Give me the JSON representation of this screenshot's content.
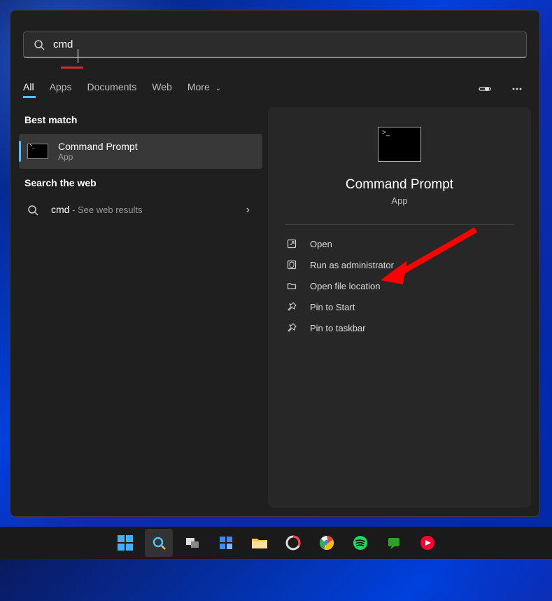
{
  "search": {
    "query": "cmd"
  },
  "tabs": {
    "items": [
      "All",
      "Apps",
      "Documents",
      "Web",
      "More"
    ],
    "active_index": 0
  },
  "left": {
    "section_best": "Best match",
    "best_result": {
      "title": "Command Prompt",
      "subtitle": "App"
    },
    "section_web": "Search the web",
    "web_result": {
      "query": "cmd",
      "suffix": " - See web results"
    }
  },
  "preview": {
    "title": "Command Prompt",
    "subtitle": "App",
    "actions": [
      {
        "icon": "open-external-icon",
        "label": "Open"
      },
      {
        "icon": "shield-icon",
        "label": "Run as administrator"
      },
      {
        "icon": "folder-icon",
        "label": "Open file location"
      },
      {
        "icon": "pin-icon",
        "label": "Pin to Start"
      },
      {
        "icon": "pin-icon",
        "label": "Pin to taskbar"
      }
    ]
  },
  "annotation": {
    "arrow_color": "#ff0000",
    "points_to": "Run as administrator"
  },
  "taskbar": {
    "items": [
      {
        "name": "start-icon"
      },
      {
        "name": "search-icon",
        "active": true
      },
      {
        "name": "task-view-icon"
      },
      {
        "name": "widgets-icon"
      },
      {
        "name": "file-explorer-icon"
      },
      {
        "name": "app-icon-1"
      },
      {
        "name": "chrome-icon"
      },
      {
        "name": "spotify-icon"
      },
      {
        "name": "chat-icon"
      },
      {
        "name": "app-icon-2"
      }
    ]
  }
}
